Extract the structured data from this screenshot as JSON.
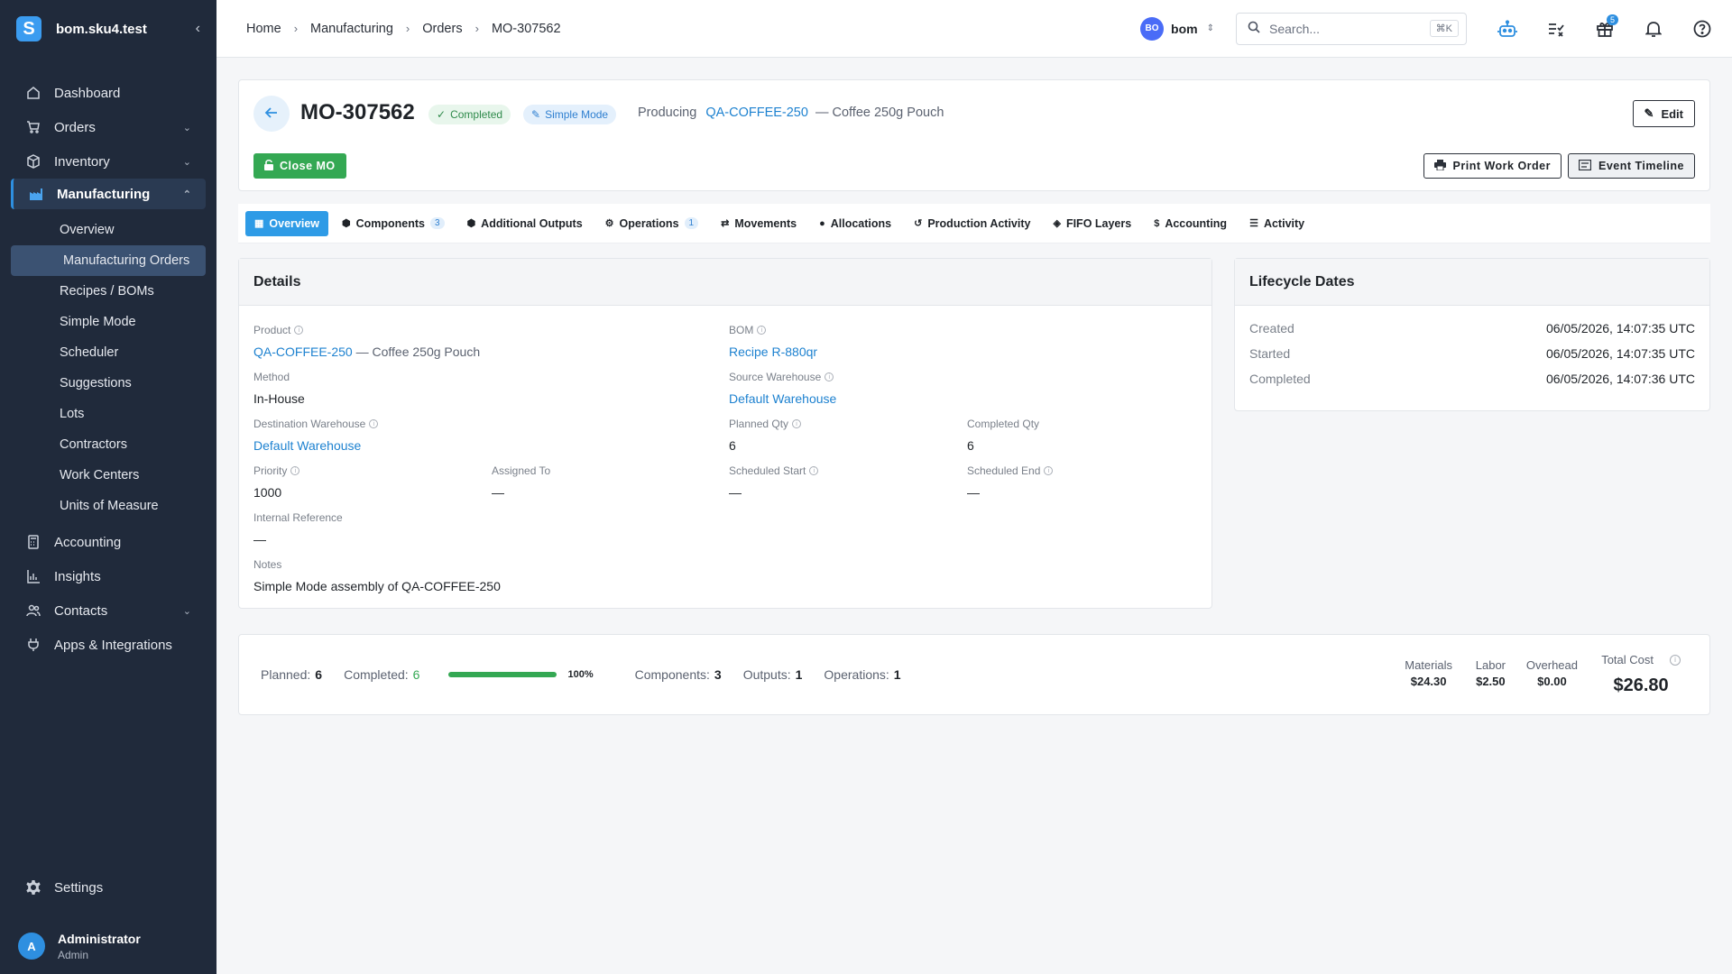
{
  "sidebar": {
    "brand": "bom.sku4.test",
    "items": [
      {
        "label": "Dashboard"
      },
      {
        "label": "Orders"
      },
      {
        "label": "Inventory"
      },
      {
        "label": "Manufacturing"
      },
      {
        "label": "Accounting"
      },
      {
        "label": "Insights"
      },
      {
        "label": "Contacts"
      },
      {
        "label": "Apps & Integrations"
      }
    ],
    "manufacturing_sub": [
      {
        "label": "Overview"
      },
      {
        "label": "Manufacturing Orders"
      },
      {
        "label": "Recipes / BOMs"
      },
      {
        "label": "Simple Mode"
      },
      {
        "label": "Scheduler"
      },
      {
        "label": "Suggestions"
      },
      {
        "label": "Lots"
      },
      {
        "label": "Contractors"
      },
      {
        "label": "Work Centers"
      },
      {
        "label": "Units of Measure"
      }
    ],
    "settings": "Settings",
    "user": {
      "initial": "A",
      "name": "Administrator",
      "role": "Admin"
    }
  },
  "topbar": {
    "breadcrumb": [
      "Home",
      "Manufacturing",
      "Orders",
      "MO-307562"
    ],
    "org_initials": "BO",
    "org_name": "bom",
    "search_placeholder": "Search...",
    "search_shortcut": "⌘K",
    "gift_badge": "5"
  },
  "header": {
    "mo_number": "MO-307562",
    "status": "Completed",
    "mode": "Simple Mode",
    "producing_label": "Producing",
    "product_sku": "QA-COFFEE-250",
    "product_name": "— Coffee 250g Pouch",
    "edit": "Edit",
    "close_mo": "Close MO",
    "print": "Print Work Order",
    "timeline": "Event Timeline"
  },
  "tabs": [
    {
      "label": "Overview"
    },
    {
      "label": "Components",
      "count": "3"
    },
    {
      "label": "Additional Outputs"
    },
    {
      "label": "Operations",
      "count": "1"
    },
    {
      "label": "Movements"
    },
    {
      "label": "Allocations"
    },
    {
      "label": "Production Activity"
    },
    {
      "label": "FIFO Layers"
    },
    {
      "label": "Accounting"
    },
    {
      "label": "Activity"
    }
  ],
  "details": {
    "title": "Details",
    "product_label": "Product",
    "product_sku": "QA-COFFEE-250",
    "product_name": "— Coffee 250g Pouch",
    "bom_label": "BOM",
    "bom_value": "Recipe R-880qr",
    "method_label": "Method",
    "method_value": "In-House",
    "source_wh_label": "Source Warehouse",
    "source_wh_value": "Default Warehouse",
    "dest_wh_label": "Destination Warehouse",
    "dest_wh_value": "Default Warehouse",
    "planned_qty_label": "Planned Qty",
    "planned_qty_value": "6",
    "completed_qty_label": "Completed Qty",
    "completed_qty_value": "6",
    "priority_label": "Priority",
    "priority_value": "1000",
    "assigned_label": "Assigned To",
    "assigned_value": "—",
    "sched_start_label": "Scheduled Start",
    "sched_start_value": "—",
    "sched_end_label": "Scheduled End",
    "sched_end_value": "—",
    "internal_ref_label": "Internal Reference",
    "internal_ref_value": "—",
    "notes_label": "Notes",
    "notes_value": "Simple Mode assembly of QA-COFFEE-250"
  },
  "lifecycle": {
    "title": "Lifecycle Dates",
    "rows": [
      {
        "key": "Created",
        "value": "06/05/2026, 14:07:35 UTC"
      },
      {
        "key": "Started",
        "value": "06/05/2026, 14:07:35 UTC"
      },
      {
        "key": "Completed",
        "value": "06/05/2026, 14:07:36 UTC"
      }
    ]
  },
  "summary": {
    "planned_label": "Planned:",
    "planned_value": "6",
    "completed_label": "Completed:",
    "completed_value": "6",
    "progress_fraction": 1.0,
    "progress_pct": "100%",
    "components_label": "Components:",
    "components_value": "3",
    "outputs_label": "Outputs:",
    "outputs_value": "1",
    "operations_label": "Operations:",
    "operations_value": "1",
    "materials_label": "Materials",
    "materials_value": "$24.30",
    "labor_label": "Labor",
    "labor_value": "$2.50",
    "overhead_label": "Overhead",
    "overhead_value": "$0.00",
    "total_label": "Total Cost",
    "total_value": "$26.80"
  },
  "colors": {
    "sidebar_bg": "#202a3b",
    "accent": "#2e8fe0",
    "success": "#34a853",
    "link": "#1e82d0"
  }
}
